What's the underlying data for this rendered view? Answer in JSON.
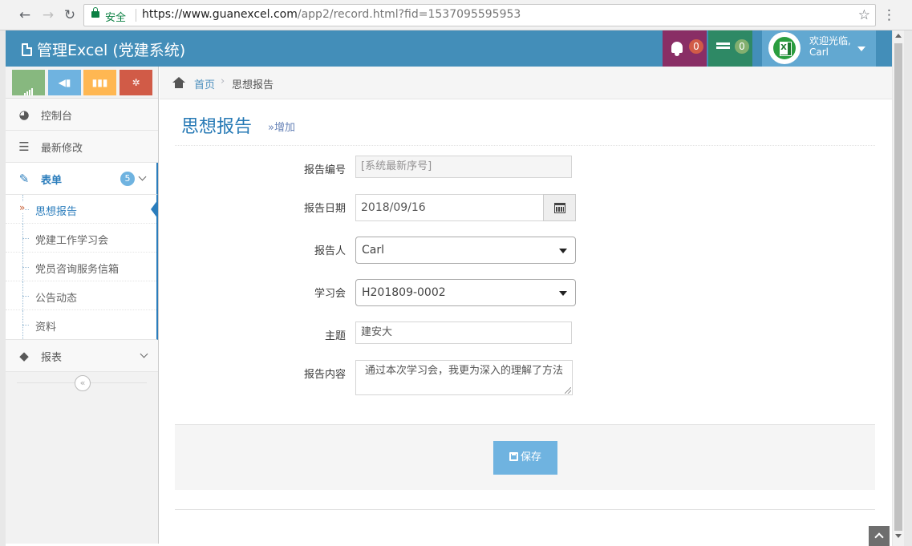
{
  "browser": {
    "secure_label": "安全",
    "url_host": "https://www.guanexcel.com",
    "url_rest": "/app2/record.html?fid=1537095595953"
  },
  "header": {
    "brand": "管理Excel (党建系统)",
    "notifications_count": "0",
    "tasks_count": "0",
    "welcome": "欢迎光临,",
    "username": "Carl",
    "colors": {
      "bar": "#438eb9",
      "notify": "#892e65",
      "tasks": "#2e8965",
      "user": "#62a8d1"
    }
  },
  "sidebar": {
    "items": [
      {
        "label": "控制台",
        "icon": "tachometer-icon"
      },
      {
        "label": "最新修改",
        "icon": "list-icon"
      },
      {
        "label": "表单",
        "icon": "edit-icon",
        "count": "5"
      },
      {
        "label": "报表",
        "icon": "tag-icon"
      }
    ],
    "submenu": [
      {
        "label": "思想报告"
      },
      {
        "label": "党建工作学习会"
      },
      {
        "label": "党员咨询服务信箱"
      },
      {
        "label": "公告动态"
      },
      {
        "label": "资料"
      }
    ]
  },
  "breadcrumb": {
    "home": "首页",
    "separator": "›",
    "current": "思想报告"
  },
  "page": {
    "title": "思想报告",
    "subtitle": "»增加"
  },
  "form": {
    "report_no_label": "报告编号",
    "report_no_value": "[系统最新序号]",
    "date_label": "报告日期",
    "date_value": "2018/09/16",
    "reporter_label": "报告人",
    "reporter_value": "Carl",
    "meeting_label": "学习会",
    "meeting_value": "H201809-0002",
    "subject_label": "主题",
    "subject_value": "建安大",
    "content_label": "报告内容",
    "content_value": "通过本次学习会，我更为深入的理解了方法",
    "save_label": "保存"
  }
}
